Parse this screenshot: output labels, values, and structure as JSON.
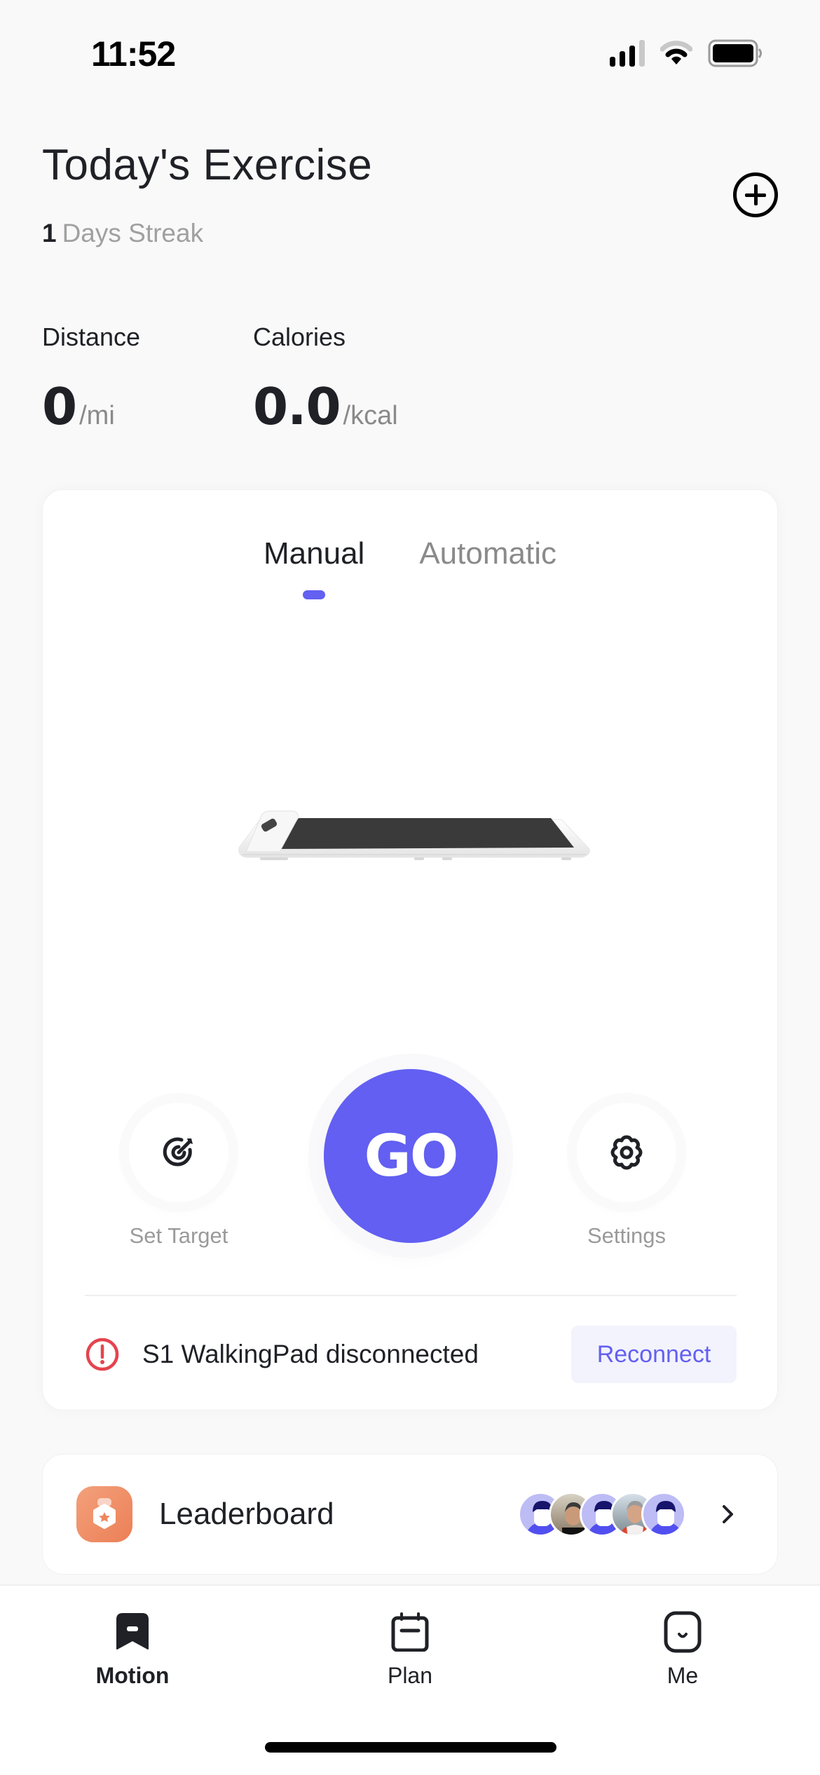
{
  "status_bar": {
    "time": "11:52",
    "icons": [
      "cellular-signal-icon",
      "wifi-icon",
      "battery-icon"
    ]
  },
  "header": {
    "title": "Today's Exercise",
    "streak_count": "1",
    "streak_label": "Days Streak",
    "add_icon": "plus-circle-icon"
  },
  "stats": [
    {
      "label": "Distance",
      "value": "0",
      "unit": "/mi"
    },
    {
      "label": "Calories",
      "value": "0.0",
      "unit": "/kcal"
    }
  ],
  "mode_tabs": [
    {
      "label": "Manual",
      "active": true
    },
    {
      "label": "Automatic",
      "active": false
    }
  ],
  "device": {
    "image": "walkingpad-treadmill"
  },
  "actions": {
    "set_target_label": "Set Target",
    "set_target_icon": "target-icon",
    "go_label": "GO",
    "settings_label": "Settings",
    "settings_icon": "gear-icon"
  },
  "connection": {
    "status_text": "S1 WalkingPad disconnected",
    "status_icon": "alert-circle-icon",
    "reconnect_label": "Reconnect"
  },
  "leaderboard": {
    "title": "Leaderboard",
    "icon": "kettlebell-icon",
    "avatars": [
      "default-avatar",
      "user-photo",
      "default-avatar",
      "user-photo",
      "default-avatar"
    ]
  },
  "tab_bar": [
    {
      "label": "Motion",
      "icon": "motion-icon",
      "active": true
    },
    {
      "label": "Plan",
      "icon": "calendar-icon",
      "active": false
    },
    {
      "label": "Me",
      "icon": "profile-icon",
      "active": false
    }
  ],
  "colors": {
    "accent": "#625ff2",
    "warning": "#e5444f",
    "leaderboard_icon": "#ee875e",
    "reconnect_bg": "#f3f3fd"
  }
}
